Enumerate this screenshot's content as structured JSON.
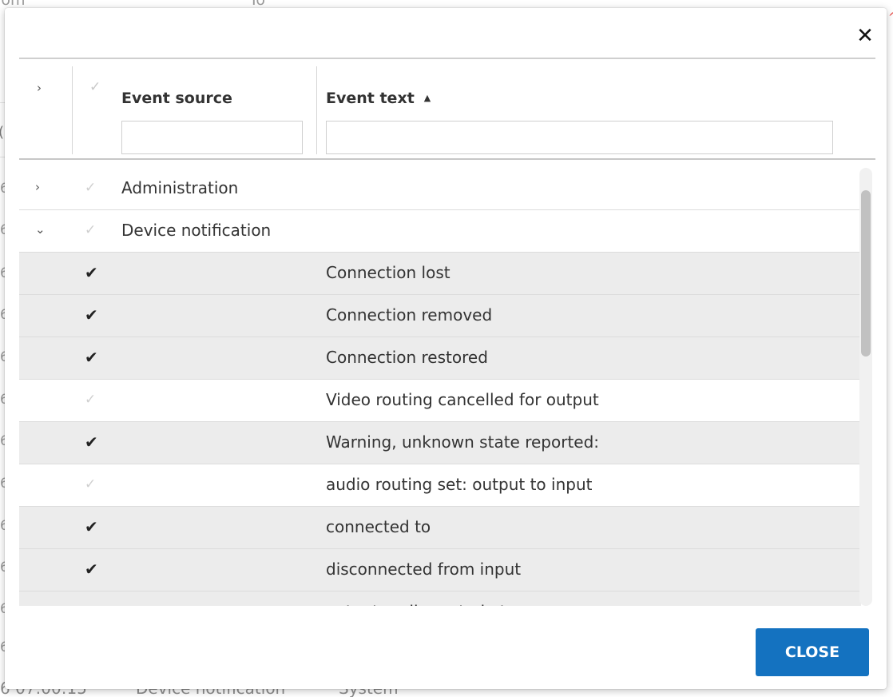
{
  "background": {
    "col_from": "rom",
    "col_to": "To",
    "bottom_time": "6 07:00:15",
    "bottom_source": "Device notification",
    "bottom_user": "System",
    "row_digit": "6",
    "header_letter": "("
  },
  "dialog": {
    "close_icon": "close-icon",
    "table": {
      "header": {
        "expand_icon": "chevron-right-icon",
        "check_icon": "checkmark-icon",
        "event_source_label": "Event source",
        "event_text_label": "Event text",
        "sort_icon": "sort-ascending-icon",
        "event_source_filter": "",
        "event_text_filter": ""
      },
      "groups": [
        {
          "label": "Administration",
          "expanded": false
        },
        {
          "label": "Device notification",
          "expanded": true
        }
      ],
      "rows": [
        {
          "text": "Connection lost",
          "checked": true
        },
        {
          "text": "Connection removed",
          "checked": true
        },
        {
          "text": "Connection restored",
          "checked": true
        },
        {
          "text": "Video routing cancelled for output",
          "checked": false
        },
        {
          "text": "Warning, unknown state reported:",
          "checked": true
        },
        {
          "text": "audio routing set: output to input",
          "checked": false
        },
        {
          "text": "connected to",
          "checked": true
        },
        {
          "text": "disconnected from input",
          "checked": true
        },
        {
          "text": "output audio muted at",
          "checked": true
        }
      ]
    },
    "close_button_label": "CLOSE"
  },
  "colors": {
    "accent": "#1472c0",
    "checked_row_bg": "#ececec"
  }
}
